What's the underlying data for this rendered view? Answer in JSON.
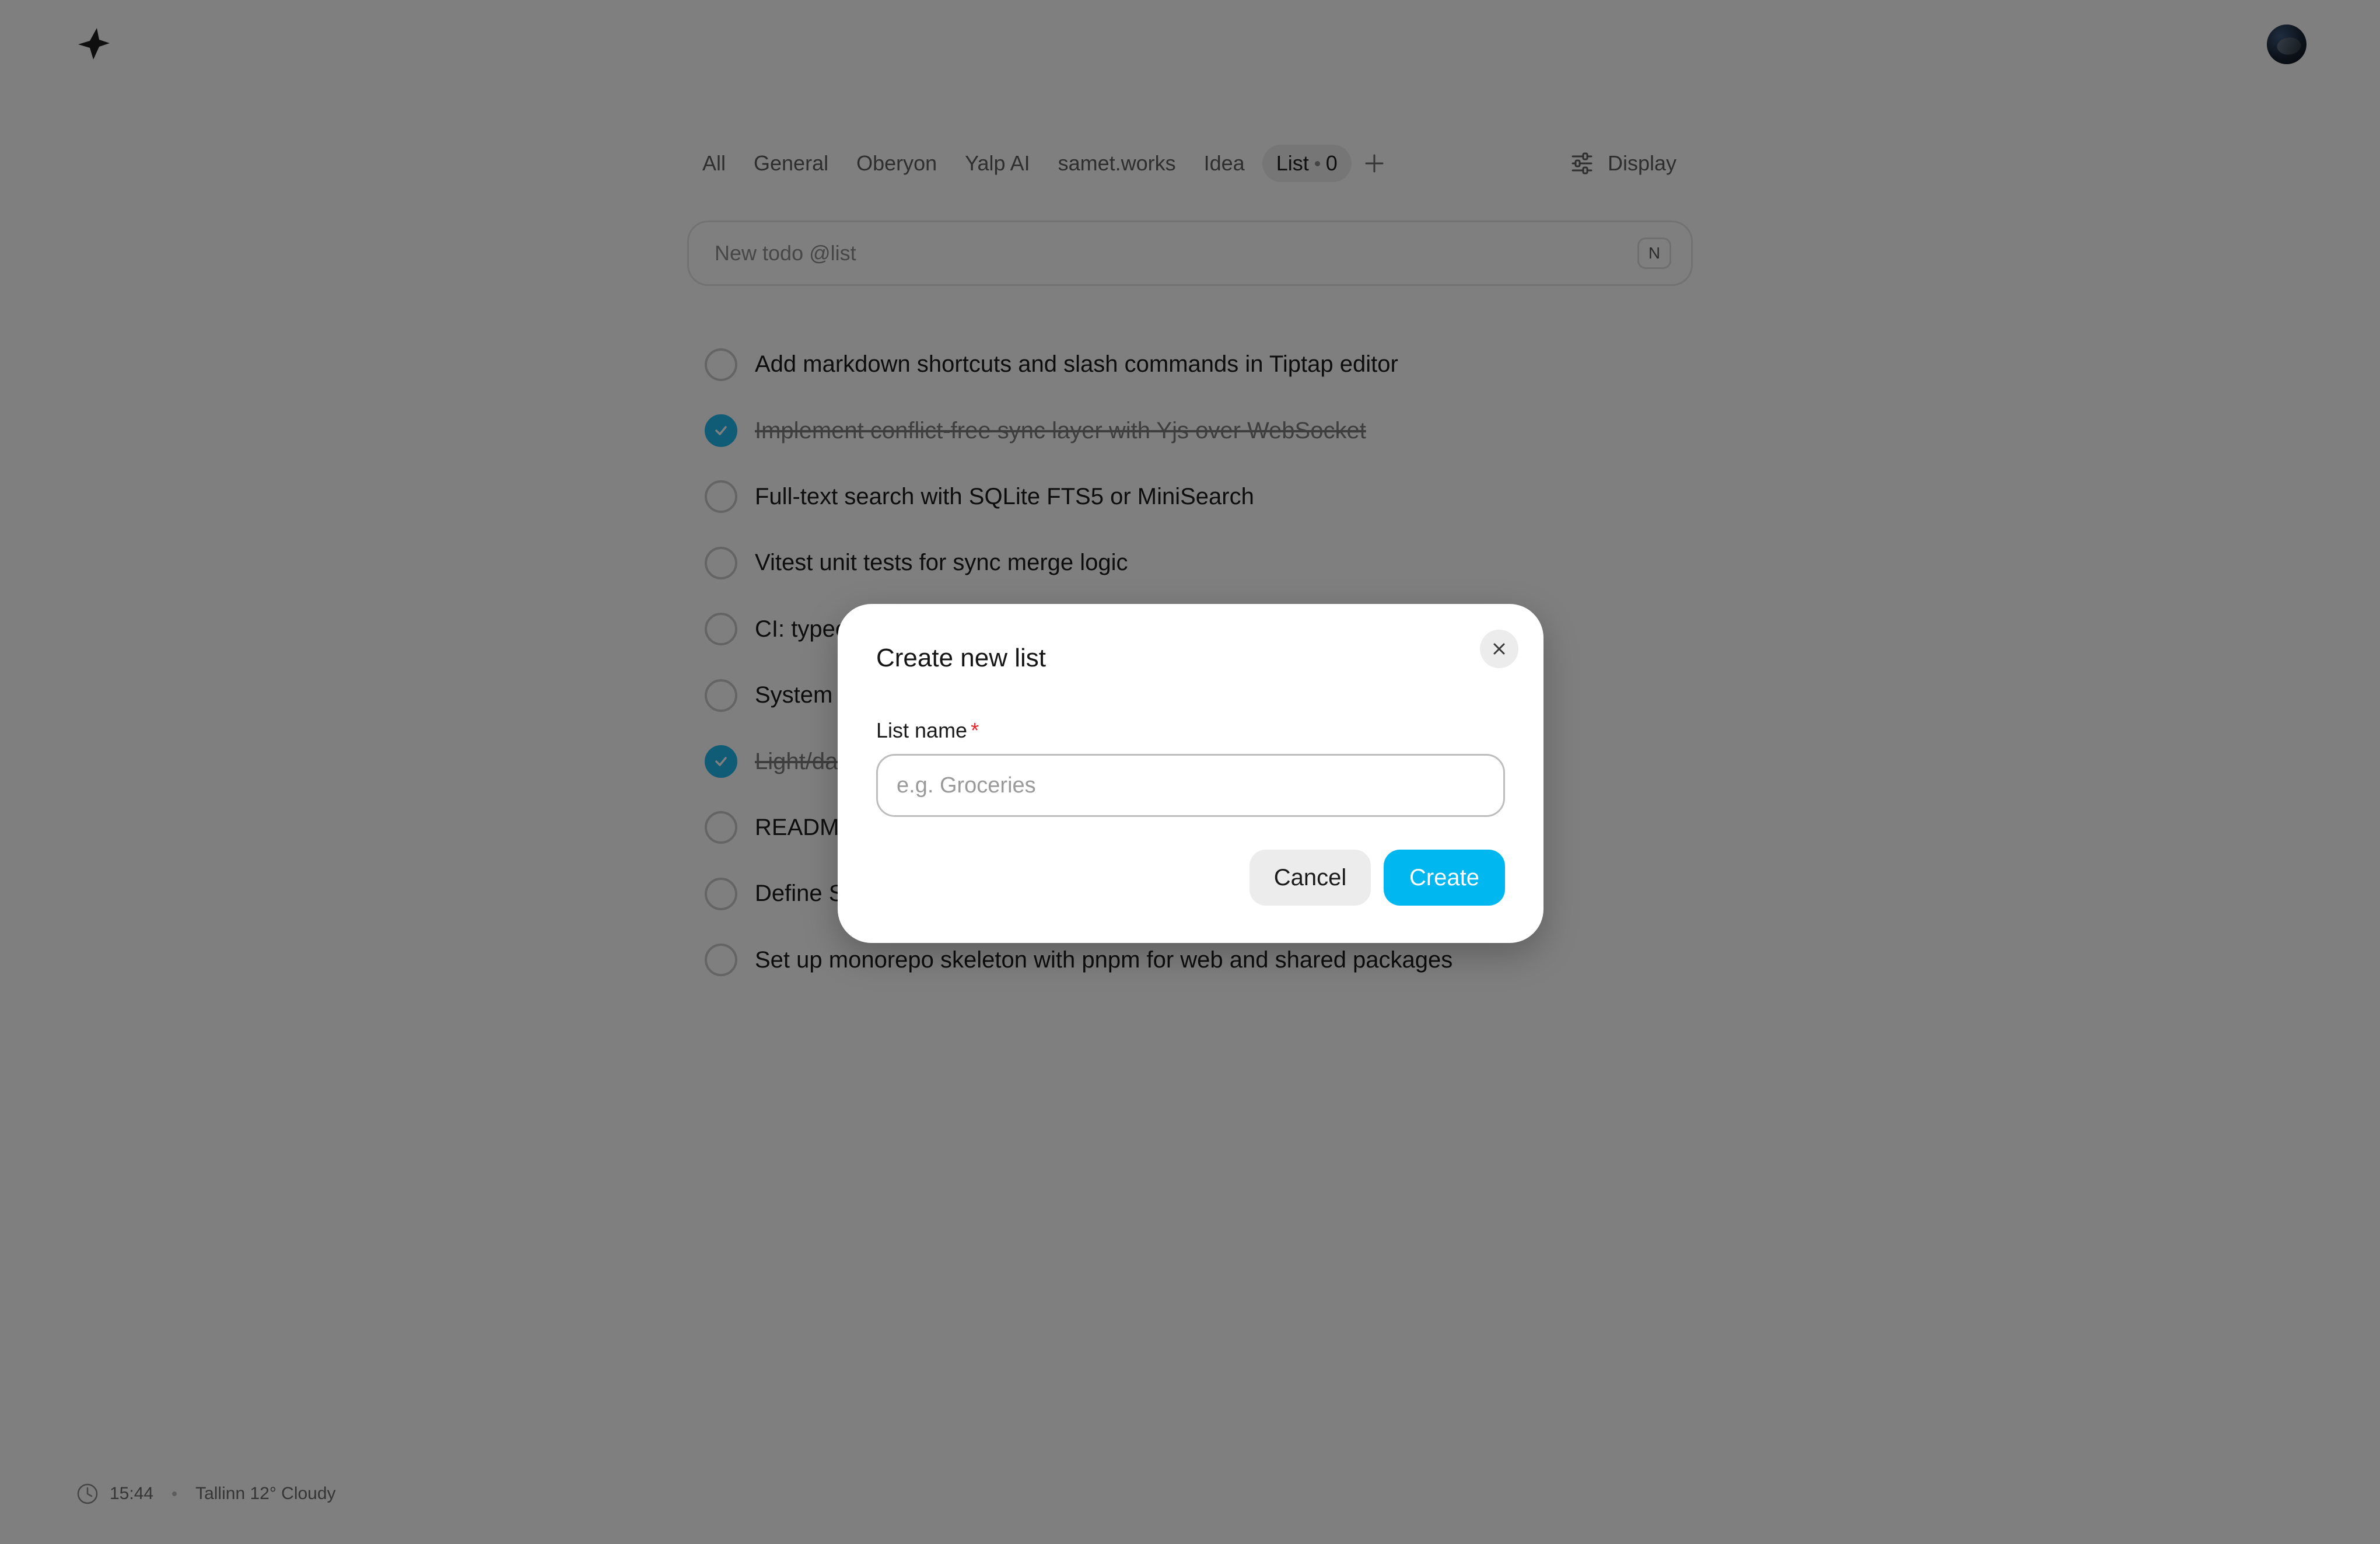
{
  "header": {
    "logo_icon": "sparkle-logo-icon",
    "avatar_icon": "user-avatar"
  },
  "tabs": [
    {
      "label": "All"
    },
    {
      "label": "General"
    },
    {
      "label": "Oberyon"
    },
    {
      "label": "Yalp AI"
    },
    {
      "label": "samet.works"
    },
    {
      "label": "Idea"
    },
    {
      "label": "List",
      "count": "0",
      "active": true
    }
  ],
  "toolbar": {
    "add_tab_icon": "plus-icon",
    "display_label": "Display",
    "display_icon": "sliders-icon"
  },
  "new_todo": {
    "placeholder": "New todo @list",
    "shortcut": "N"
  },
  "todos": [
    {
      "text": "Add markdown shortcuts and slash commands in Tiptap editor",
      "done": false
    },
    {
      "text": "Implement conflict-free sync layer with Yjs over WebSocket",
      "done": true
    },
    {
      "text": "Full-text search with SQLite FTS5 or MiniSearch",
      "done": false
    },
    {
      "text": "Vitest unit tests for sync merge logic",
      "done": false
    },
    {
      "text": "CI: typec",
      "done": false
    },
    {
      "text": "System",
      "done": false
    },
    {
      "text": "Light/da",
      "done": true
    },
    {
      "text": "READMI",
      "done": false
    },
    {
      "text": "Define S",
      "done": false
    },
    {
      "text": "Set up monorepo skeleton with pnpm for web and shared packages",
      "done": false
    }
  ],
  "footer": {
    "time": "15:44",
    "weather": "Tallinn 12° Cloudy",
    "clock_icon": "clock-icon"
  },
  "modal": {
    "title": "Create new list",
    "field_label": "List name",
    "required_mark": "*",
    "placeholder": "e.g. Groceries",
    "value": "",
    "cancel_label": "Cancel",
    "create_label": "Create",
    "close_icon": "close-icon"
  },
  "colors": {
    "accent": "#00b7ef",
    "checkbox_checked": "#20b9ec",
    "required": "#e5252a",
    "overlay": "rgba(0,0,0,0.5)"
  }
}
